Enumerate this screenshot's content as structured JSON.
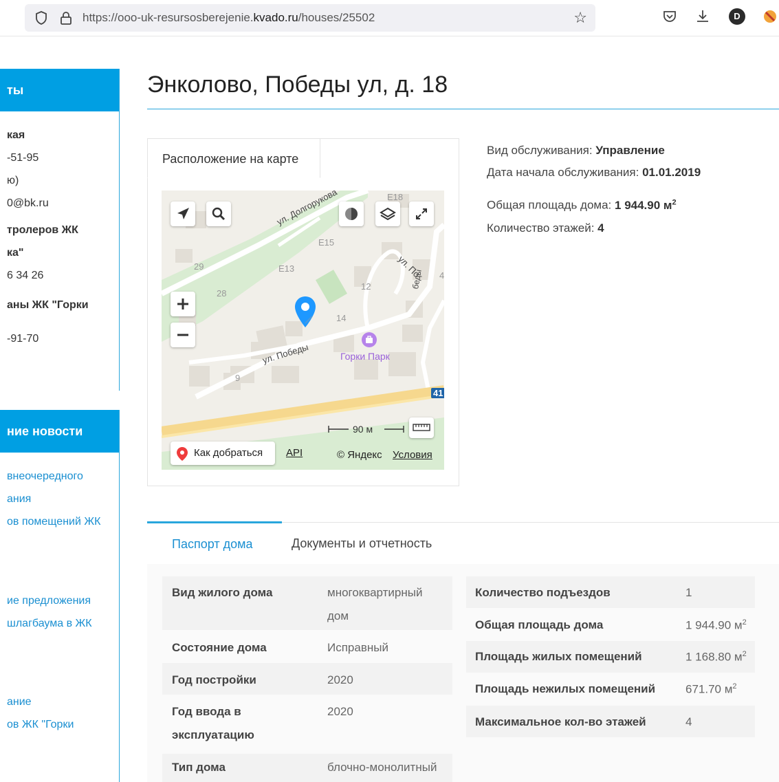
{
  "browser": {
    "url_prefix": "https://ooo-uk-resursosberejenie.",
    "url_domain": "kvado.ru",
    "url_path": "/houses/25502",
    "profile_initial": "D"
  },
  "sidebar": {
    "contacts_heading": "ты",
    "contacts_lines": [
      "кая",
      "-51-95",
      "ю)",
      "0@bk.ru",
      "тролеров ЖК",
      "ка\"",
      "6 34 26",
      "аны ЖК \"Горки",
      "-91-70"
    ],
    "news_heading": "ние новости",
    "news_links": [
      "внеочередного",
      "ания",
      "ов помещений ЖК",
      "ие предложения",
      "шлагбаума в ЖК",
      "ание",
      "ов ЖК \"Горки"
    ]
  },
  "page": {
    "title": "Энколово, Победы ул, д. 18"
  },
  "map": {
    "tab_label": "Расположение на карте",
    "labels": {
      "street1": "ул. Долгорукова",
      "street2": "ул. Победы",
      "street3": "ул. По",
      "street3b": "беды",
      "e18": "E18",
      "e15": "E15",
      "e13": "E13",
      "n29": "29",
      "n28": "28",
      "n12": "12",
      "n14": "14",
      "n9": "9",
      "n4": "4",
      "n41": "41",
      "poi": "Горки Парк"
    },
    "scale": "90 м",
    "route_button": "Как добраться",
    "api_link": "API",
    "copyright": "© Яндекс",
    "terms_link": "Условия"
  },
  "info": {
    "service_type_label": "Вид обслуживания:",
    "service_type_value": "Управление",
    "start_date_label": "Дата начала обслуживания:",
    "start_date_value": "01.01.2019",
    "area_label": "Общая площадь дома:",
    "area_value": "1 944.90 м",
    "floors_label": "Количество этажей:",
    "floors_value": "4"
  },
  "tabs": {
    "passport": "Паспорт дома",
    "documents": "Документы и отчетность"
  },
  "passport_left": [
    {
      "label": "Вид жилого дома",
      "value1": "многоквартирный",
      "value2": "дом"
    },
    {
      "label": "Состояние дома",
      "value1": "Исправный"
    },
    {
      "label": "Год постройки",
      "value1": "2020"
    },
    {
      "label1": "Год ввода в",
      "label2": "эксплуатацию",
      "value1": "2020"
    },
    {
      "label": "Тип дома",
      "value1": "блочно-монолитный"
    }
  ],
  "passport_right": [
    {
      "label": "Количество подъездов",
      "value": "1"
    },
    {
      "label": "Общая площадь дома",
      "value": "1 944.90 м"
    },
    {
      "label": "Площадь жилых помещений",
      "value": "1 168.80 м"
    },
    {
      "label": "Площадь нежилых помещений",
      "value": "671.70 м"
    },
    {
      "label": "Максимальное кол-во этажей",
      "value": "4"
    }
  ],
  "superscript": "2",
  "colors": {
    "accent": "#009fe3",
    "link": "#1a8fd1",
    "pin": "#1e98ff"
  }
}
